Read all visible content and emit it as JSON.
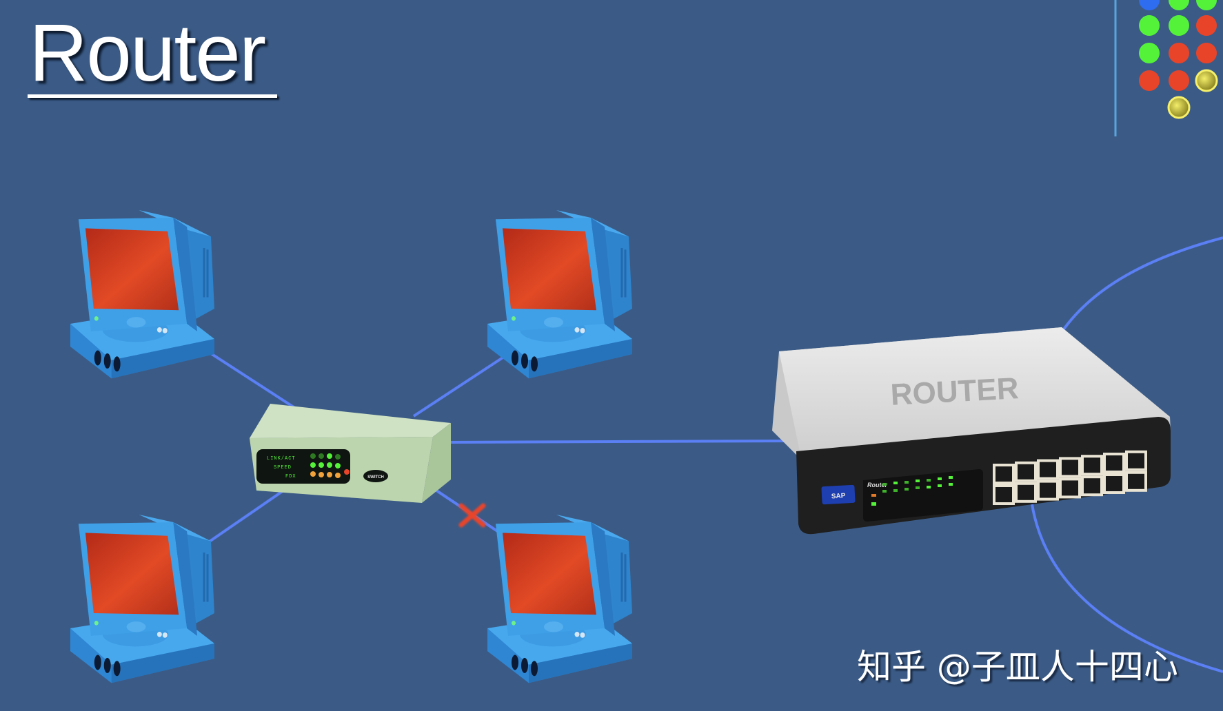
{
  "slide": {
    "title": "Router",
    "watermark": "知乎 @子皿人十四心"
  },
  "colors": {
    "background": "#3b5b86",
    "cable": "#5b7ff5",
    "computer_body": "#3d9de6",
    "computer_screen": "#c5361d",
    "switch_body": "#c3d9b6",
    "router_top": "#d9d9d9",
    "router_front": "#1f1f1f",
    "led_green": "#55f23a",
    "led_red": "#e8442a",
    "led_yellow": "#e6e040",
    "led_blue": "#2f6df0",
    "led_orange": "#f2a23a",
    "break_mark": "#e8442a"
  },
  "nodes": {
    "computers": [
      {
        "id": "pc-top-left",
        "label": ""
      },
      {
        "id": "pc-top-right",
        "label": ""
      },
      {
        "id": "pc-bottom-left",
        "label": ""
      },
      {
        "id": "pc-bottom-right",
        "label": ""
      }
    ],
    "switch": {
      "label": "SWITCH",
      "led_rows": [
        "LINK/ACT",
        "SPEED",
        "FDX"
      ]
    },
    "router": {
      "top_label": "ROUTER",
      "front_label": "Router",
      "badge": "SAP",
      "port_count": 14
    }
  },
  "connections": [
    {
      "from": "pc-top-left",
      "to": "switch",
      "status": "ok"
    },
    {
      "from": "pc-top-right",
      "to": "switch",
      "status": "ok"
    },
    {
      "from": "pc-bottom-left",
      "to": "switch",
      "status": "ok"
    },
    {
      "from": "pc-bottom-right",
      "to": "switch",
      "status": "broken"
    },
    {
      "from": "switch",
      "to": "router",
      "status": "ok"
    },
    {
      "from": "router",
      "to": "offscreen-top-right",
      "status": "ok"
    },
    {
      "from": "router",
      "to": "offscreen-bottom-right",
      "status": "ok"
    }
  ],
  "indicator_grid": [
    [
      "blue",
      "green",
      "green"
    ],
    [
      "green",
      "green",
      "red"
    ],
    [
      "green",
      "red",
      "red"
    ],
    [
      "red",
      "red",
      "yellow"
    ],
    [
      null,
      "yellow",
      null
    ]
  ]
}
